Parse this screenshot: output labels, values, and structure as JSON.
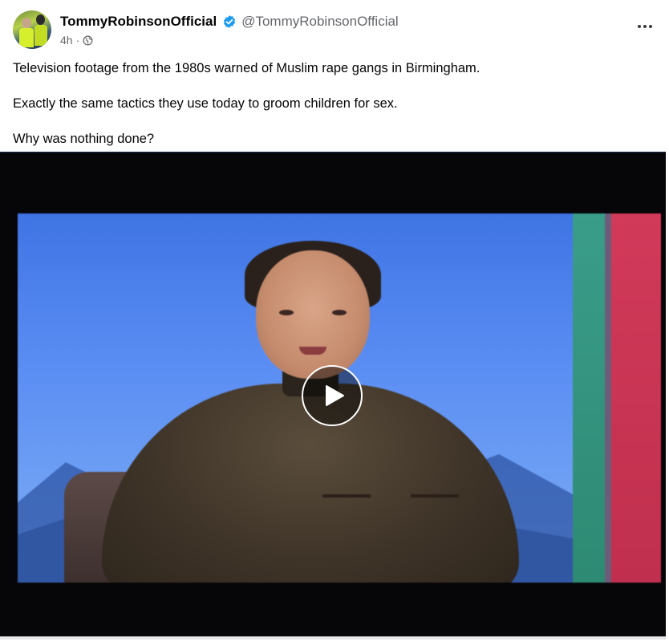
{
  "post": {
    "author": {
      "display_name": "TommyRobinsonOfficial",
      "handle": "@TommyRobinsonOfficial",
      "verified_icon": "verified-badge-icon",
      "avatar_icon": "profile-avatar"
    },
    "meta": {
      "time": "4h",
      "separator": "·",
      "audience_icon": "globe-icon"
    },
    "more_icon": "more-horizontal-icon",
    "text": {
      "line1": "Television footage from the 1980s warned of Muslim rape gangs in Birmingham.",
      "line2": "Exactly the same tactics they use today to groom children for sex.",
      "line3": "Why was nothing done?"
    },
    "video": {
      "play_icon": "play-icon"
    }
  },
  "colors": {
    "verified": "#1d9bf0",
    "secondary_text": "#65676b",
    "primary_text": "#050505",
    "video_background": "#060507"
  }
}
